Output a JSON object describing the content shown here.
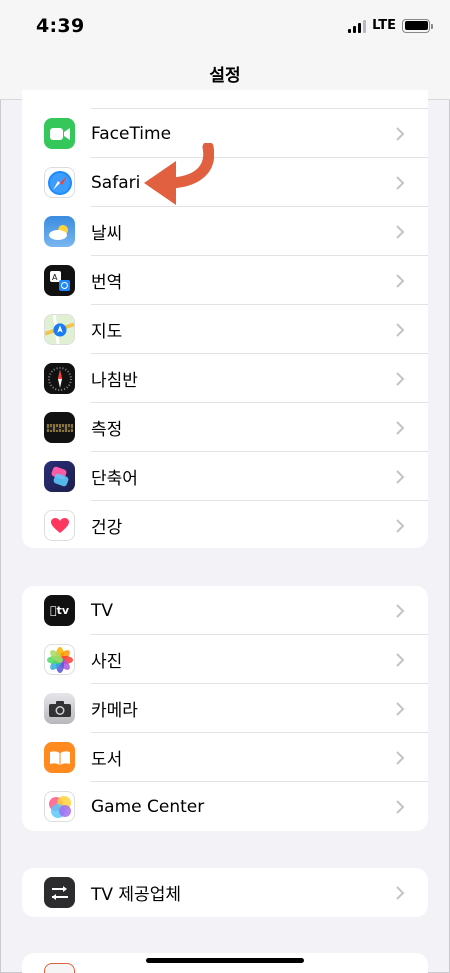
{
  "status_bar": {
    "time": "4:39",
    "network": "LTE"
  },
  "nav": {
    "title": "설정"
  },
  "group1": [
    {
      "label": "FaceTime",
      "icon": "facetime-icon"
    },
    {
      "label": "Safari",
      "icon": "safari-icon"
    },
    {
      "label": "날씨",
      "icon": "weather-icon"
    },
    {
      "label": "번역",
      "icon": "translate-icon"
    },
    {
      "label": "지도",
      "icon": "maps-icon"
    },
    {
      "label": "나침반",
      "icon": "compass-icon"
    },
    {
      "label": "측정",
      "icon": "measure-icon"
    },
    {
      "label": "단축어",
      "icon": "shortcuts-icon"
    },
    {
      "label": "건강",
      "icon": "health-icon"
    }
  ],
  "group2": [
    {
      "label": "TV",
      "icon": "apple-tv-icon"
    },
    {
      "label": "사진",
      "icon": "photos-icon"
    },
    {
      "label": "카메라",
      "icon": "camera-icon"
    },
    {
      "label": "도서",
      "icon": "books-icon"
    },
    {
      "label": "Game Center",
      "icon": "game-center-icon"
    }
  ],
  "group3": [
    {
      "label": "TV 제공업체",
      "icon": "tv-provider-icon"
    }
  ],
  "annotation": {
    "arrow_color": "#e0603f",
    "points_to": "Safari"
  }
}
